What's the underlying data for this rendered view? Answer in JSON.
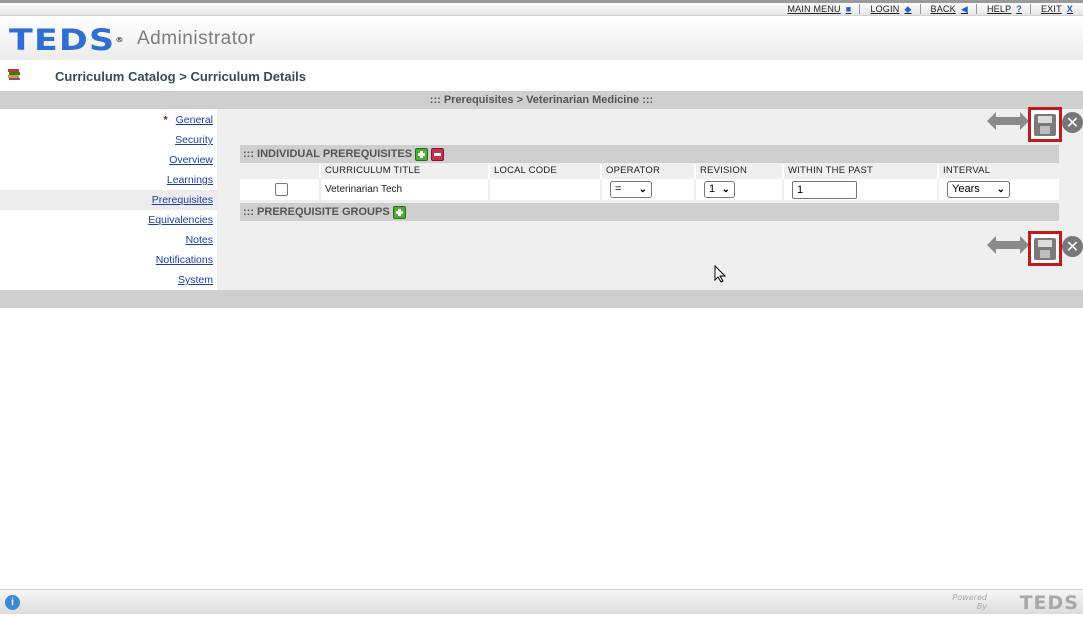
{
  "topnav": [
    {
      "label": "MAIN MENU",
      "icon": "square-icon"
    },
    {
      "label": "LOGIN",
      "icon": "diamond-icon"
    },
    {
      "label": "BACK",
      "icon": "triangle-left-icon"
    },
    {
      "label": "HELP",
      "icon": "question-icon"
    },
    {
      "label": "EXIT",
      "icon": "x-icon"
    }
  ],
  "header": {
    "logo": "TEDS",
    "logo_mark": "®",
    "app_name": "Administrator"
  },
  "breadcrumb": "Curriculum Catalog > Curriculum Details",
  "section_title": "::: Prerequisites > Veterinarian Medicine :::",
  "nav": {
    "required_marker": "*",
    "items": [
      "General",
      "Security",
      "Overview",
      "Learnings",
      "Prerequisites",
      "Equivalencies",
      "Notes",
      "Notifications",
      "System"
    ]
  },
  "individual": {
    "title": "::: INDIVIDUAL PREREQUISITES",
    "columns": [
      "",
      "CURRICULUM TITLE",
      "LOCAL CODE",
      "OPERATOR",
      "REVISION",
      "WITHIN THE PAST",
      "INTERVAL"
    ],
    "rows": [
      {
        "title": "Veterinarian Tech",
        "local_code": "",
        "operator": "=",
        "revision": "1",
        "within": "1",
        "interval": "Years"
      }
    ]
  },
  "groups": {
    "title": "::: PREREQUISITE GROUPS"
  },
  "colors": {
    "accent": "#2f6fd2",
    "save_highlight": "#c21a1a",
    "bar": "#cfcfcf",
    "link": "#1a3ea8"
  },
  "footer": {
    "powered_text": "Powered By",
    "powered_logo": "TEDS",
    "info_icon": "i"
  }
}
